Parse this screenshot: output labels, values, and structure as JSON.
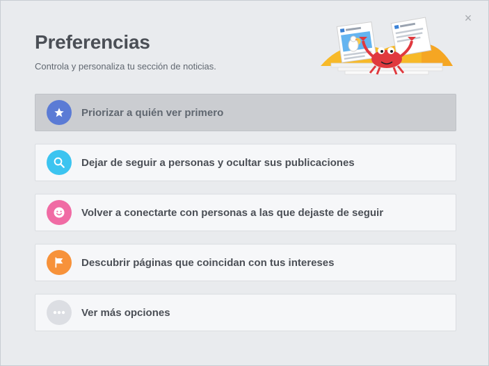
{
  "dialog": {
    "title": "Preferencias",
    "subtitle": "Controla y personaliza tu sección de noticias.",
    "close_label": "×"
  },
  "options": [
    {
      "label": "Priorizar a quién ver primero",
      "icon": "star-icon",
      "color": "#5b7bd5",
      "selected": true
    },
    {
      "label": "Dejar de seguir a personas y ocultar sus publicaciones",
      "icon": "search-icon",
      "color": "#3cc4f0",
      "selected": false
    },
    {
      "label": "Volver a conectarte con personas a las que dejaste de seguir",
      "icon": "smiley-icon",
      "color": "#f06ba4",
      "selected": false
    },
    {
      "label": "Descubrir páginas que coincidan con tus intereses",
      "icon": "flag-icon",
      "color": "#f7923a",
      "selected": false
    },
    {
      "label": "Ver más opciones",
      "icon": "more-icon",
      "color": "#dcdee3",
      "selected": false
    }
  ],
  "colors": {
    "background": "#e9ebee",
    "text": "#4b4f56",
    "selected_row": "#cbcdd1"
  }
}
